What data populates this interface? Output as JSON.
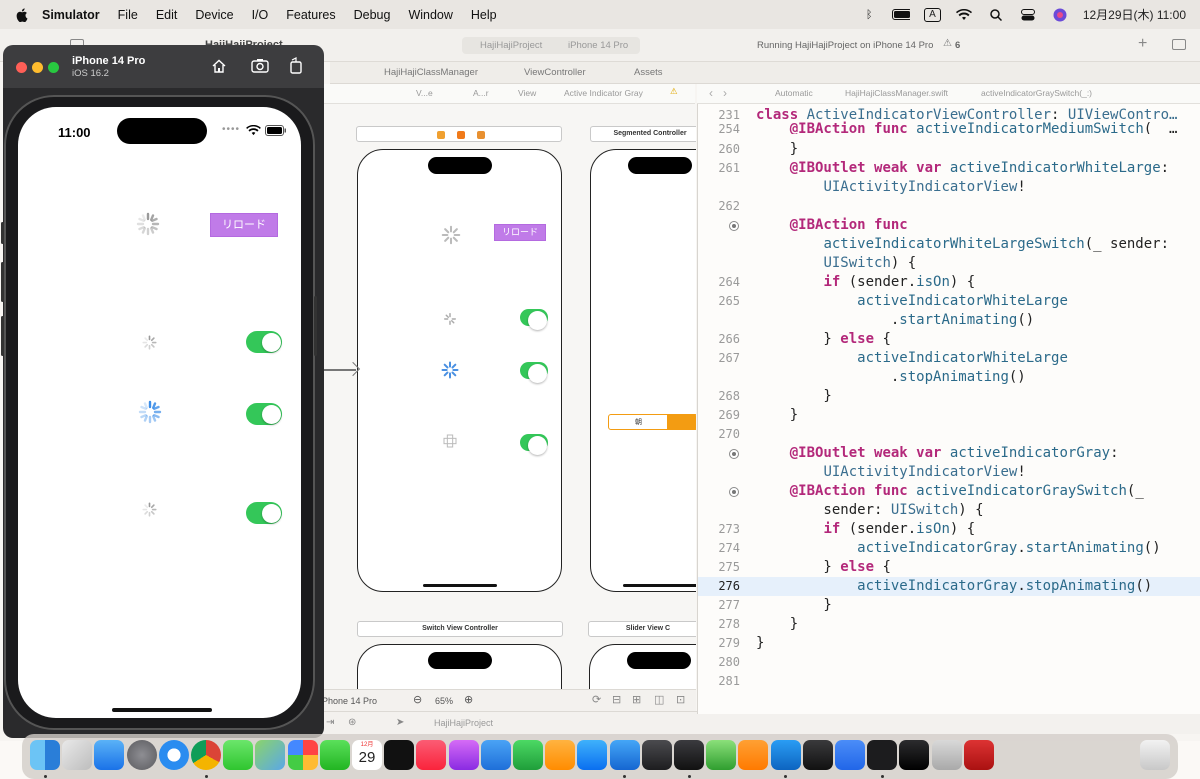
{
  "menubar": {
    "apple": "",
    "app": "Simulator",
    "items": [
      "File",
      "Edit",
      "Device",
      "I/O",
      "Features",
      "Debug",
      "Window",
      "Help"
    ],
    "input_mode": "A",
    "clock": "12月29日(木) 11:00"
  },
  "simulator": {
    "device_name": "iPhone 14 Pro",
    "os_version": "iOS 16.2",
    "status_time": "11:00",
    "reload_button": "リロード"
  },
  "xcode": {
    "project_title": "HajiHajiProject",
    "breadcrumb_project": "HajiHajiProject",
    "breadcrumb_device": "iPhone 14 Pro",
    "status": "Running HajiHajiProject on iPhone 14 Pro",
    "warning_count": "6",
    "tabs": [
      "HajiHajiClassManager",
      "ViewController",
      "Assets"
    ],
    "jump_items": [
      "V...e",
      "A...r",
      "View",
      "Active Indicator Gray"
    ],
    "code_jump": [
      "Automatic",
      "HajiHajiClassManager.swift",
      "activeIndicatorGraySwitch(_:)"
    ],
    "scene_labels": {
      "segmented": "Segmented Controller",
      "switch_vc": "Switch View Controller",
      "slider": "Slider View C"
    },
    "scene_reload": "リロード",
    "segment_label": "朝",
    "canvas_device": "iPhone 14 Pro",
    "zoom": "65%",
    "nav_project": "HajiHajiProject"
  },
  "code": {
    "lines": [
      {
        "n": "231",
        "t": "class ActiveIndicatorViewController: UIViewContro…"
      },
      {
        "n": "254",
        "t": "    @IBAction func activeIndicatorMediumSwitch(_ …"
      },
      {
        "n": "260",
        "t": "    }"
      },
      {
        "n": "261",
        "t": "    @IBOutlet weak var activeIndicatorWhiteLarge:"
      },
      {
        "n": "",
        "t": "        UIActivityIndicatorView!"
      },
      {
        "n": "262",
        "t": ""
      },
      {
        "n": "",
        "t": "    @IBAction func"
      },
      {
        "n": "",
        "t": "        activeIndicatorWhiteLargeSwitch(_ sender:"
      },
      {
        "n": "",
        "t": "        UISwitch) {"
      },
      {
        "n": "264",
        "t": "        if (sender.isOn) {"
      },
      {
        "n": "265",
        "t": "            activeIndicatorWhiteLarge"
      },
      {
        "n": "",
        "t": "                .startAnimating()"
      },
      {
        "n": "266",
        "t": "        } else {"
      },
      {
        "n": "267",
        "t": "            activeIndicatorWhiteLarge"
      },
      {
        "n": "",
        "t": "                .stopAnimating()"
      },
      {
        "n": "268",
        "t": "        }"
      },
      {
        "n": "269",
        "t": "    }"
      },
      {
        "n": "270",
        "t": ""
      },
      {
        "n": "",
        "t": "    @IBOutlet weak var activeIndicatorGray:"
      },
      {
        "n": "",
        "t": "        UIActivityIndicatorView!"
      },
      {
        "n": "",
        "t": "    @IBAction func activeIndicatorGraySwitch(_"
      },
      {
        "n": "",
        "t": "        sender: UISwitch) {"
      },
      {
        "n": "273",
        "t": "        if (sender.isOn) {"
      },
      {
        "n": "274",
        "t": "            activeIndicatorGray.startAnimating()"
      },
      {
        "n": "275",
        "t": "        } else {"
      },
      {
        "n": "276",
        "t": "            activeIndicatorGray.stopAnimating()"
      },
      {
        "n": "277",
        "t": "        }"
      },
      {
        "n": "278",
        "t": "    }"
      },
      {
        "n": "279",
        "t": "}"
      },
      {
        "n": "280",
        "t": ""
      },
      {
        "n": "281",
        "t": ""
      }
    ]
  },
  "dock": {
    "calendar_month": "12月",
    "calendar_day": "29",
    "apps": [
      "finder",
      "launchpad",
      "mail",
      "system-settings",
      "safari",
      "chrome",
      "messages",
      "maps",
      "photos",
      "facetime",
      "tv",
      "music",
      "podcasts",
      "keynote",
      "numbers",
      "pages",
      "app-store",
      "xcode",
      "instruments",
      "simulator",
      "coteditor",
      "books",
      "vscode",
      "dev-tool",
      "zoom",
      "terminal",
      "xcode-alt",
      "font-book",
      "kana-dict",
      "trash"
    ]
  },
  "colors": {
    "switch_on": "#34c759",
    "reload_button": "#c07be8",
    "keyword": "#b3287a",
    "current_line": "#e6f0fb"
  }
}
